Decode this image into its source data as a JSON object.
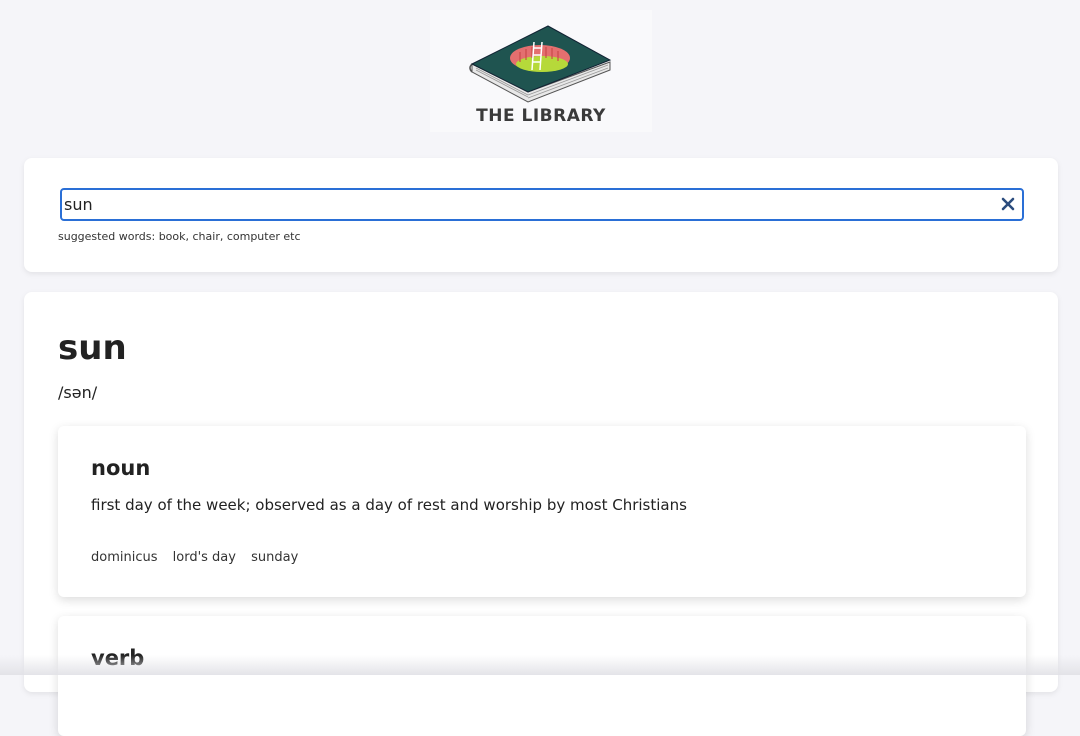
{
  "app": {
    "title": "THE LIBRARY",
    "logo_icon": "book-logo-icon"
  },
  "search": {
    "value": "sun",
    "placeholder": "",
    "clear_icon": "close-icon",
    "hint": "suggested words: book, chair, computer etc"
  },
  "result": {
    "word": "sun",
    "phonetic": "/sən/",
    "meanings": [
      {
        "part_of_speech": "noun",
        "definition": "first day of the week; observed as a day of rest and worship by most Christians",
        "synonyms": [
          "dominicus",
          "lord's day",
          "sunday"
        ]
      },
      {
        "part_of_speech": "verb"
      }
    ]
  },
  "colors": {
    "accent": "#2a6fd6",
    "page_background": "#f5f5f9",
    "book_cover": "#1f5450"
  }
}
